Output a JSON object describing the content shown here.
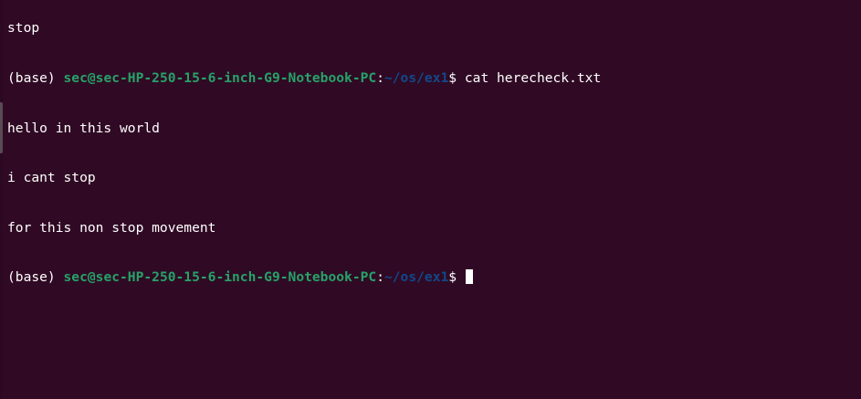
{
  "terminal": {
    "lines": [
      {
        "type": "output",
        "text": "stop"
      },
      {
        "type": "prompt",
        "env": "(base)",
        "user_host": "sec@sec-HP-250-15-6-inch-G9-Notebook-PC",
        "sep": ":",
        "path": "~/os/ex1",
        "symbol": "$",
        "command": "cat herecheck.txt"
      },
      {
        "type": "output",
        "text": "hello in this world"
      },
      {
        "type": "output",
        "text": "i cant stop"
      },
      {
        "type": "output",
        "text": "for this non stop movement"
      },
      {
        "type": "prompt",
        "env": "(base)",
        "user_host": "sec@sec-HP-250-15-6-inch-G9-Notebook-PC",
        "sep": ":",
        "path": "~/os/ex1",
        "symbol": "$",
        "command": ""
      }
    ]
  },
  "colors": {
    "background": "#300a24",
    "user_host": "#26a269",
    "path": "#12488b",
    "text": "#ffffff"
  }
}
